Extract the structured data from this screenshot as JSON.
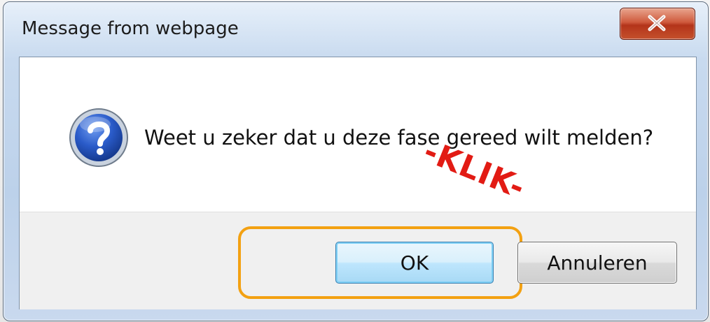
{
  "dialog": {
    "title": "Message from webpage",
    "message": "Weet u zeker dat u deze fase gereed wilt melden?",
    "icon": "question-icon",
    "buttons": {
      "ok_label": "OK",
      "cancel_label": "Annuleren"
    },
    "annotation": "-KLIK-"
  },
  "colors": {
    "highlight": "#f3a112",
    "annotation": "#e21b14",
    "close_button": "#c4502c"
  }
}
